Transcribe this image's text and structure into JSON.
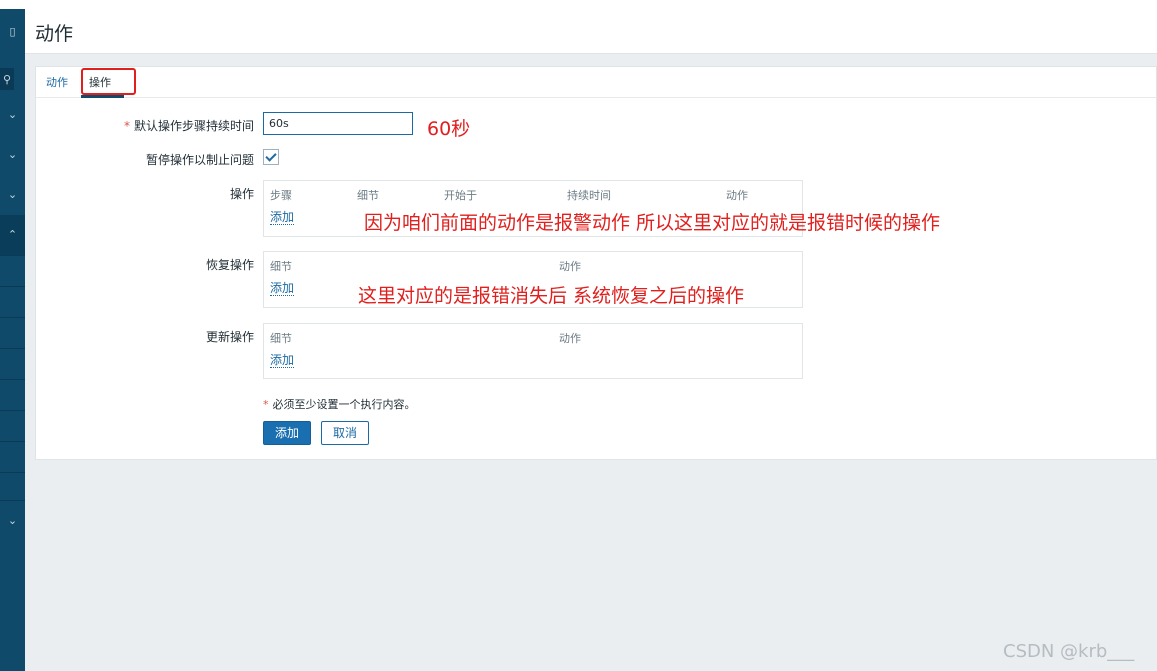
{
  "page": {
    "title": "动作"
  },
  "tabs": [
    {
      "label": "动作",
      "active": false
    },
    {
      "label": "操作",
      "active": true
    }
  ],
  "form": {
    "default_duration": {
      "label": "默认操作步骤持续时间",
      "required": true,
      "value": "60s"
    },
    "pause_operations": {
      "label": "暂停操作以制止问题",
      "checked": true
    },
    "operations": {
      "label": "操作",
      "columns": [
        "步骤",
        "细节",
        "开始于",
        "持续时间",
        "动作"
      ],
      "add_link": "添加"
    },
    "recovery_operations": {
      "label": "恢复操作",
      "columns": [
        "细节",
        "动作"
      ],
      "add_link": "添加"
    },
    "update_operations": {
      "label": "更新操作",
      "columns": [
        "细节",
        "动作"
      ],
      "add_link": "添加"
    },
    "required_note": "必须至少设置一个执行内容。",
    "required_mark": "*"
  },
  "buttons": {
    "add": "添加",
    "cancel": "取消"
  },
  "annotations": {
    "duration": "60秒",
    "operations": "因为咱们前面的动作是报警动作 所以这里对应的就是报错时候的操作",
    "recovery": "这里对应的是报错消失后 系统恢复之后的操作"
  },
  "watermark": "CSDN @krb___",
  "colors": {
    "sidebar": "#0f4a6b",
    "accent": "#1a6fb0",
    "annotation": "#e0201e",
    "link": "#1c6aa3"
  }
}
